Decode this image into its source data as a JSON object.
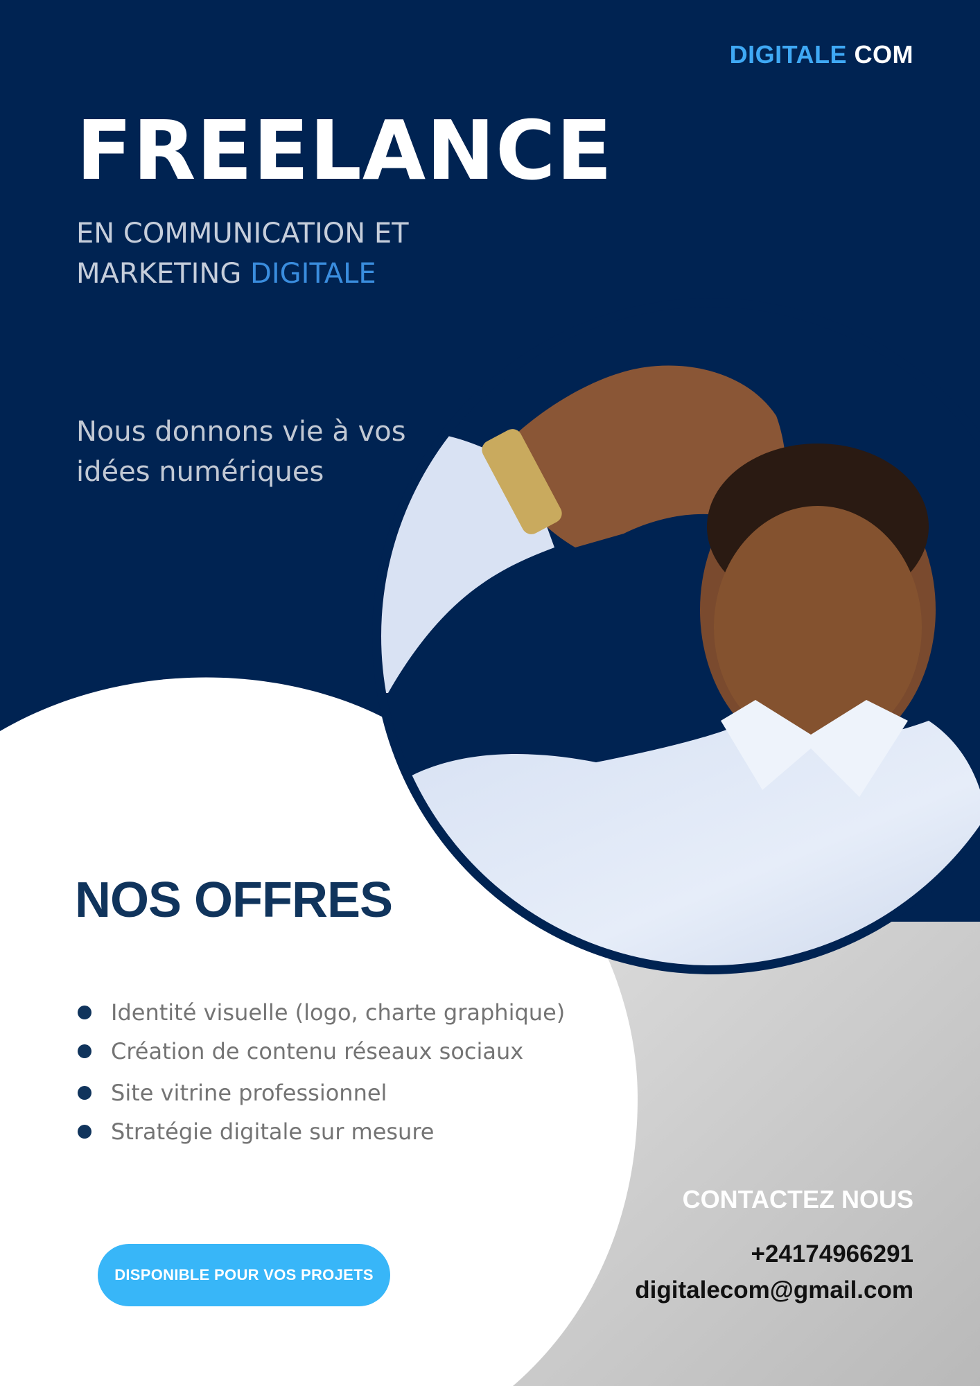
{
  "brand": {
    "part1": "DIGITALE",
    "part2": "COM"
  },
  "hero": {
    "title": "FREELANCE",
    "subtitle_line1": "EN COMMUNICATION ET",
    "subtitle_line2_prefix": "MARKETING",
    "subtitle_line2_accent": "DIGITALE",
    "tagline": "Nous donnons vie à vos idées numériques"
  },
  "offers": {
    "title": "NOS OFFRES",
    "items": [
      "Identité visuelle (logo, charte graphique)",
      "Création de contenu réseaux sociaux",
      "Site vitrine professionnel",
      "Stratégie digitale sur mesure"
    ]
  },
  "cta": {
    "label": "DISPONIBLE POUR VOS PROJETS"
  },
  "contact": {
    "title": "CONTACTEZ NOUS",
    "phone": "+24174966291",
    "email": "digitalecom@gmail.com"
  },
  "colors": {
    "navy": "#002352",
    "accent_blue": "#3fa9f5",
    "heading_navy": "#10345c",
    "button_blue": "#38b6f8",
    "gray_panel": "#c8c8c8"
  },
  "photo": {
    "subject": "portrait-photo"
  }
}
